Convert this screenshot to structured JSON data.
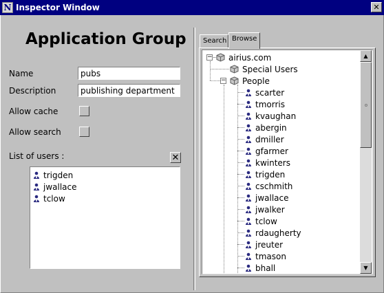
{
  "window": {
    "title": "Inspector Window",
    "icon": "N"
  },
  "form": {
    "heading": "Application Group",
    "name_label": "Name",
    "name_value": "pubs",
    "description_label": "Description",
    "description_value": "publishing department",
    "allow_cache_label": "Allow cache",
    "allow_cache_checked": false,
    "allow_search_label": "Allow search",
    "allow_search_checked": false,
    "users_label": "List of users :",
    "users": [
      "trigden",
      "jwallace",
      "tclow"
    ]
  },
  "tabs": {
    "search": "Search",
    "browse": "Browse",
    "active": "Browse"
  },
  "tree": {
    "root": "airius.com",
    "special_users": "Special Users",
    "people": "People",
    "people_items": [
      "scarter",
      "tmorris",
      "kvaughan",
      "abergin",
      "dmiller",
      "gfarmer",
      "kwinters",
      "trigden",
      "cschmith",
      "jwallace",
      "jwalker",
      "tclow",
      "rdaugherty",
      "jreuter",
      "tmason",
      "bhall"
    ]
  },
  "colors": {
    "titlebar": "#000080",
    "face": "#c0c0c0",
    "person_icon": "#2a2a80"
  }
}
